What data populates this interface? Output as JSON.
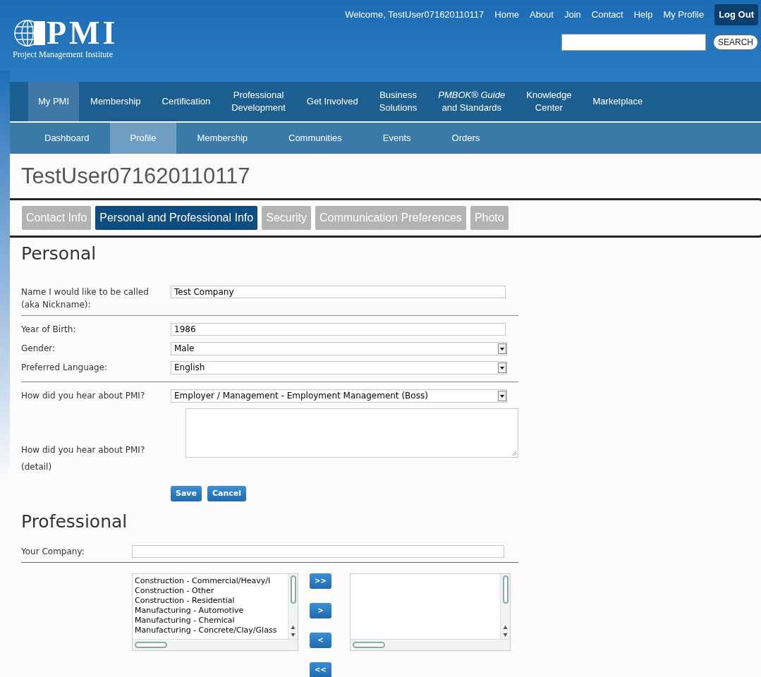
{
  "header": {
    "logo_text": "PMI",
    "logo_subtitle": "Project Management Institute",
    "welcome": "Welcome, TestUser071620110117",
    "links": [
      "Home",
      "About",
      "Join",
      "Contact",
      "Help",
      "My Profile"
    ],
    "logout": "Log Out",
    "search_button": "SEARCH"
  },
  "main_nav": [
    {
      "lines": [
        "My PMI"
      ],
      "selected": true
    },
    {
      "lines": [
        "Membership"
      ],
      "selected": false
    },
    {
      "lines": [
        "Certification"
      ],
      "selected": false
    },
    {
      "lines": [
        "Professional",
        "Development"
      ],
      "selected": false
    },
    {
      "lines": [
        "Get Involved"
      ],
      "selected": false
    },
    {
      "lines": [
        "Business",
        "Solutions"
      ],
      "selected": false
    },
    {
      "lines": [
        "*PMBOK® Guide*",
        "and Standards"
      ],
      "selected": false
    },
    {
      "lines": [
        "Knowledge",
        "Center"
      ],
      "selected": false
    },
    {
      "lines": [
        "Marketplace"
      ],
      "selected": false
    }
  ],
  "sub_nav": [
    {
      "label": "Dashboard",
      "selected": false
    },
    {
      "label": "Profile",
      "selected": true
    },
    {
      "label": "Membership",
      "selected": false
    },
    {
      "label": "Communities",
      "selected": false
    },
    {
      "label": "Events",
      "selected": false
    },
    {
      "label": "Orders",
      "selected": false
    }
  ],
  "page_title": "TestUser071620110117",
  "tabs": [
    {
      "label": "Contact Info",
      "selected": false
    },
    {
      "label": "Personal and Professional Info",
      "selected": true
    },
    {
      "label": "Security",
      "selected": false
    },
    {
      "label": "Communication Preferences",
      "selected": false
    },
    {
      "label": "Photo",
      "selected": false
    }
  ],
  "personal": {
    "heading": "Personal",
    "groups": [
      [
        {
          "kind": "text",
          "label": "Name I would like to be called (aka Nickname):",
          "value": "Test Company"
        }
      ],
      [
        {
          "kind": "text",
          "label": "Year of Birth:",
          "value": "1986"
        },
        {
          "kind": "select",
          "label": "Gender:",
          "value": "Male"
        },
        {
          "kind": "select",
          "label": "Preferred Language:",
          "value": "English"
        }
      ],
      [
        {
          "kind": "select",
          "label": "How did you hear about PMI?",
          "value": "Employer / Management - Employment Management (Boss)"
        },
        {
          "kind": "textarea",
          "label": "How did you hear about PMI? (detail)"
        }
      ]
    ],
    "buttons": [
      "Save",
      "Cancel"
    ]
  },
  "professional": {
    "heading": "Professional",
    "company_label": "Your Company:",
    "available": [
      "Construction - Commercial/Heavy/I",
      "Construction - Other",
      "Construction - Residential",
      "Manufacturing - Automotive",
      "Manufacturing - Chemical",
      "Manufacturing - Concrete/Clay/Glass"
    ],
    "move_buttons": [
      ">>",
      ">",
      "<",
      "<<"
    ]
  }
}
